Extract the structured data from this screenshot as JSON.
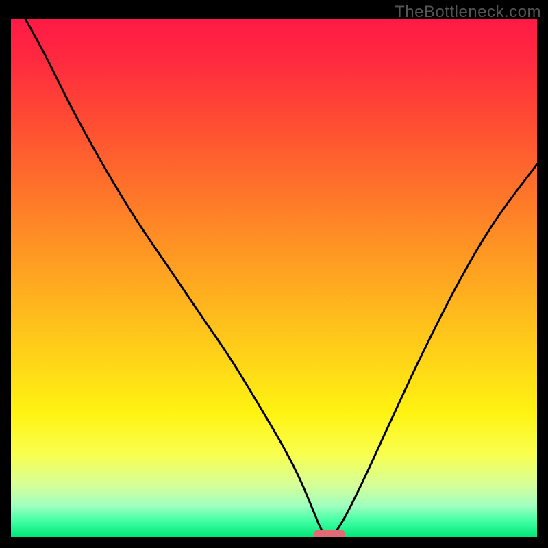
{
  "watermark": "TheBottleneck.com",
  "colors": {
    "frame_background": "#000000",
    "curve_stroke": "#000000",
    "marker_fill": "#e06b74",
    "gradient_top": "#ff1a46",
    "gradient_bottom": "#00e676"
  },
  "chart_data": {
    "type": "line",
    "title": "",
    "xlabel": "",
    "ylabel": "",
    "xlim": [
      0,
      100
    ],
    "ylim": [
      0,
      100
    ],
    "grid": false,
    "legend": false,
    "background": "rainbow-vertical-gradient",
    "series": [
      {
        "name": "bottleneck-curve",
        "x": [
          0,
          6,
          12,
          18,
          24,
          30,
          36,
          42,
          48,
          52,
          55,
          57.5,
          59,
          60.5,
          63,
          67,
          72,
          78,
          85,
          92,
          100
        ],
        "y": [
          105,
          94,
          82,
          71,
          61,
          52,
          43,
          34,
          24,
          17,
          11,
          5,
          1.5,
          0,
          3,
          11,
          22,
          35,
          49,
          61,
          72
        ]
      }
    ],
    "marker": {
      "x": 60.5,
      "y": 0,
      "shape": "rounded-rect"
    }
  }
}
